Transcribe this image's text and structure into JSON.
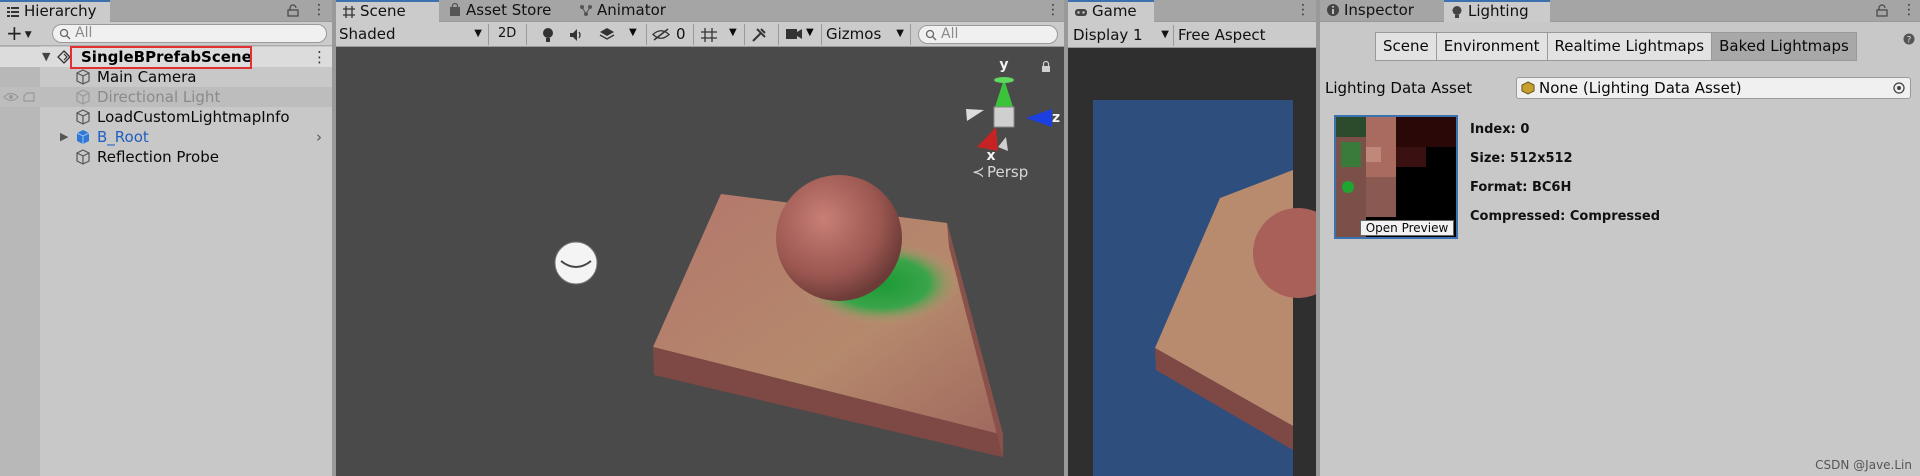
{
  "hierarchy": {
    "tab_label": "Hierarchy",
    "search_placeholder": "All",
    "add_label": "+",
    "scene_name": "SingleBPrefabScene",
    "items": [
      {
        "label": "Main Camera"
      },
      {
        "label": "Directional Light"
      },
      {
        "label": "LoadCustomLightmapInfo"
      },
      {
        "label": "B_Root"
      },
      {
        "label": "Reflection Probe"
      }
    ]
  },
  "scene": {
    "tabs": [
      "Scene",
      "Asset Store",
      "Animator"
    ],
    "shading_mode": "Shaded",
    "mode_2d": "2D",
    "hidden_count": "0",
    "gizmos_label": "Gizmos",
    "search_placeholder": "All",
    "axis_labels": {
      "y": "y",
      "z": "z",
      "x": "x"
    },
    "projection": "Persp"
  },
  "game": {
    "tab_label": "Game",
    "display": "Display 1",
    "aspect": "Free Aspect"
  },
  "inspector": {
    "tabs": [
      "Inspector",
      "Lighting"
    ],
    "section_tabs": [
      "Scene",
      "Environment",
      "Realtime Lightmaps",
      "Baked Lightmaps"
    ],
    "lighting_data_label": "Lighting Data Asset",
    "lighting_data_value": "None (Lighting Data Asset)",
    "open_preview_label": "Open Preview",
    "index": "Index: 0",
    "size": "Size: 512x512",
    "format": "Format: BC6H",
    "compressed": "Compressed: Compressed"
  },
  "watermark": "CSDN @Jave.Lin",
  "colors": {
    "accent": "#3a72b0",
    "selection_box": "#e03030",
    "viewport_bg": "#4a4a4a",
    "prefab_blue": "#1f5fbf"
  }
}
